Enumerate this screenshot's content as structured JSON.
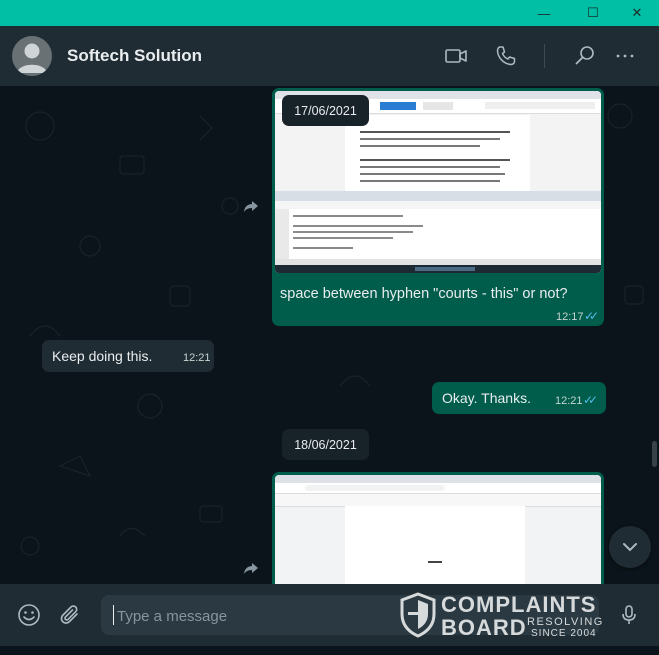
{
  "window": {
    "buttons": [
      "—",
      "☐",
      "✕"
    ],
    "accent": "#00bfa5"
  },
  "header": {
    "contact_name": "Softech Solution",
    "icons": [
      "video-call-icon",
      "voice-call-icon",
      "search-icon",
      "menu-icon"
    ]
  },
  "messages": [
    {
      "type": "image",
      "direction": "outgoing",
      "date": "17/06/2021",
      "caption": "space between hyphen \"courts - this\" or not?",
      "time": "12:17",
      "status": "read"
    },
    {
      "type": "text",
      "direction": "incoming",
      "text": "Keep doing this.",
      "time": "12:21"
    },
    {
      "type": "text",
      "direction": "outgoing",
      "text": "Okay. Thanks.",
      "time": "12:21",
      "status": "read"
    },
    {
      "type": "image",
      "direction": "outgoing",
      "date": "18/06/2021"
    }
  ],
  "footer": {
    "placeholder": "Type a message",
    "value": ""
  },
  "watermark": {
    "line1": "COMPLAINTS",
    "line2": "BOARD",
    "line3": "RESOLVING",
    "line4": "SINCE 2004"
  },
  "colors": {
    "outgoing_bubble": "#005c4b",
    "incoming_bubble": "#202c33",
    "read_ticks": "#53bdeb",
    "background": "#0b141a"
  }
}
